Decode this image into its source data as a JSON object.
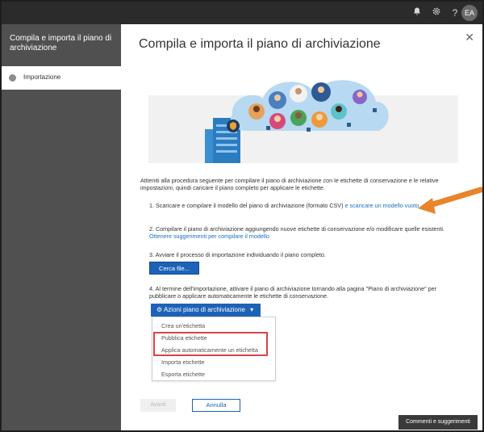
{
  "topbar": {
    "icons": [
      "bell-icon",
      "gear-icon",
      "help-icon"
    ],
    "avatar_initials": "EA"
  },
  "sidebar": {
    "title": "Compila e importa il piano di archiviazione",
    "steps": [
      {
        "label": "Importazione"
      }
    ]
  },
  "main": {
    "title": "Compila e importa il piano di archiviazione",
    "intro": "Attieniti alla procedura seguente per compilare il piano di archiviazione con le etichette di conservazione e le relative impostazioni, quindi caricare il piano completo per applicare le etichette.",
    "step1_text": "1. Scaricare e compilare il modello del piano di archiviazione (formato CSV)",
    "step1_link": "e scaricare un modello vuoto",
    "step2_text": "2. Compilare il piano di archiviazione aggiungendo nuove etichette di conservazione e/o modificare quelle esistenti.",
    "step2_link": "Ottenere suggerimenti per compilare il modello",
    "step3_text": "3. Avviare il processo di importazione individuando il piano completo.",
    "browse_button": "Cerca file...",
    "step4_text": "4. Al termine dell'importazione, attivare il piano di archiviazione tornando alla pagina \"Piano di archiviazione\" per pubblicare o applicare automaticamente le etichette di conservazione.",
    "actions_button": "Azioni piano di archiviazione",
    "menu_items": [
      "Crea un'etichetta",
      "Pubblica etichette",
      "Applica automaticamente un etichetta",
      "Importa etichette",
      "Esporta etichette"
    ],
    "back_button": "Avanti",
    "cancel_button": "Annulla",
    "feedback_button": "Commenti e suggerimenti"
  },
  "colors": {
    "topbar": "#2b2b2b",
    "sidebar": "#505050",
    "primary": "#1d62b7",
    "link": "#1a6fbf",
    "highlight": "#d64545",
    "arrow": "#e8842c",
    "cloud": "#b7d9f2"
  }
}
